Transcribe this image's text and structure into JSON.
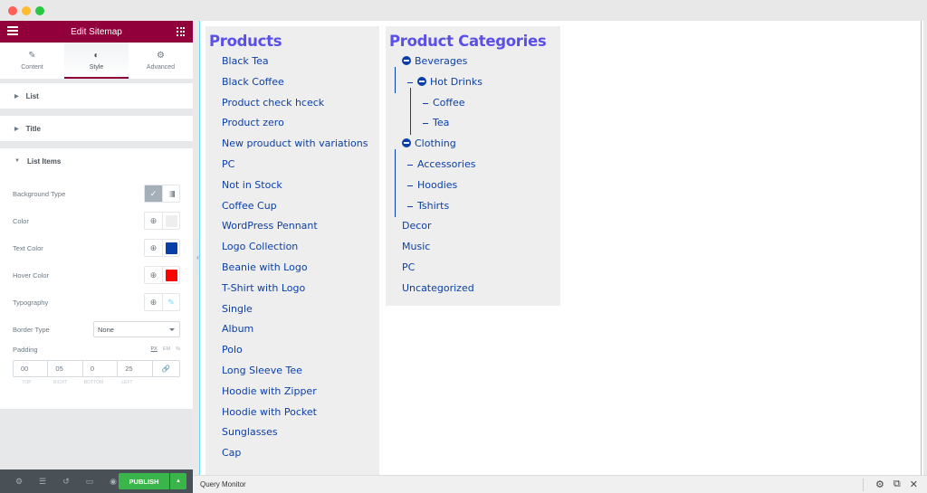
{
  "window": {
    "controls": [
      "close",
      "minimize",
      "zoom"
    ]
  },
  "panel": {
    "title": "Edit Sitemap",
    "tabs": [
      {
        "label": "Content",
        "icon": "pencil-icon",
        "active": false
      },
      {
        "label": "Style",
        "icon": "contrast-icon",
        "active": true
      },
      {
        "label": "Advanced",
        "icon": "gear-icon",
        "active": false
      }
    ],
    "sections": [
      {
        "label": "List",
        "expanded": false
      },
      {
        "label": "Title",
        "expanded": false
      },
      {
        "label": "List Items",
        "expanded": true
      }
    ],
    "controls": {
      "background_type": {
        "label": "Background Type",
        "options": [
          "classic",
          "gradient"
        ],
        "selected": "classic"
      },
      "color": {
        "label": "Color",
        "value": "#eeeeee"
      },
      "text_color": {
        "label": "Text Color",
        "value": "#0b3fa8"
      },
      "hover_color": {
        "label": "Hover Color",
        "value": "#ff0000"
      },
      "typography": {
        "label": "Typography"
      },
      "border_type": {
        "label": "Border Type",
        "value": "None"
      },
      "padding": {
        "label": "Padding",
        "units": [
          "PX",
          "EM",
          "%"
        ],
        "active_unit": "PX",
        "values": {
          "top": "00",
          "right": "05",
          "bottom": "0",
          "left": "25"
        },
        "labels": {
          "top": "TOP",
          "right": "RIGHT",
          "bottom": "BOTTOM",
          "left": "LEFT"
        }
      }
    },
    "footer": {
      "publish_label": "PUBLISH",
      "icons": [
        "settings-icon",
        "layers-icon",
        "history-icon",
        "responsive-icon",
        "preview-eye-icon"
      ]
    }
  },
  "preview": {
    "products": {
      "title": "Products",
      "items": [
        "Black Tea",
        "Black Coffee",
        "Product check hceck",
        "Product zero",
        "New prouduct with variations",
        "PC",
        "Not in Stock",
        "Coffee Cup",
        "WordPress Pennant",
        "Logo Collection",
        "Beanie with Logo",
        "T-Shirt with Logo",
        "Single",
        "Album",
        "Polo",
        "Long Sleeve Tee",
        "Hoodie with Zipper",
        "Hoodie with Pocket",
        "Sunglasses",
        "Cap"
      ]
    },
    "categories": {
      "title": "Product Categories",
      "items": [
        {
          "label": "Beverages",
          "level": 0,
          "collapsible": true
        },
        {
          "label": "Hot Drinks",
          "level": 1,
          "collapsible": true
        },
        {
          "label": "Coffee",
          "level": 2
        },
        {
          "label": "Tea",
          "level": 2
        },
        {
          "label": "Clothing",
          "level": 0,
          "collapsible": true
        },
        {
          "label": "Accessories",
          "level": 1
        },
        {
          "label": "Hoodies",
          "level": 1
        },
        {
          "label": "Tshirts",
          "level": 1
        },
        {
          "label": "Decor",
          "level": 0
        },
        {
          "label": "Music",
          "level": 0
        },
        {
          "label": "PC",
          "level": 0
        },
        {
          "label": "Uncategorized",
          "level": 0
        }
      ]
    }
  },
  "query_monitor": {
    "label": "Query Monitor",
    "icons": [
      "settings-icon",
      "popout-icon",
      "close-icon"
    ]
  }
}
